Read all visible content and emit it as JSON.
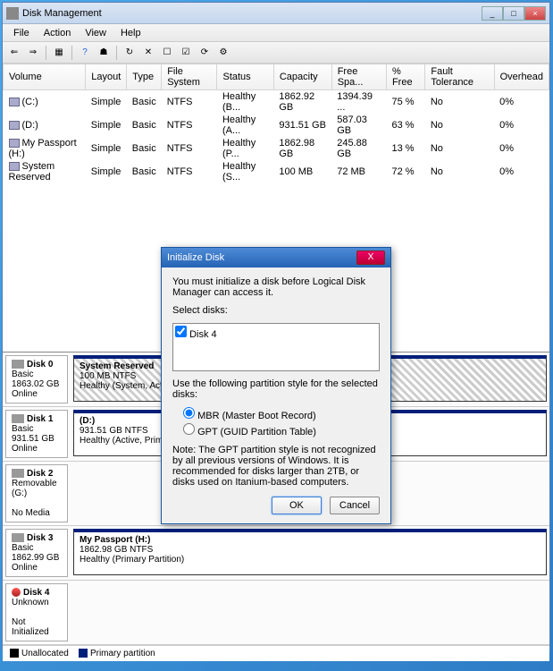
{
  "window": {
    "title": "Disk Management"
  },
  "menu": {
    "file": "File",
    "action": "Action",
    "view": "View",
    "help": "Help"
  },
  "columns": [
    "Volume",
    "Layout",
    "Type",
    "File System",
    "Status",
    "Capacity",
    "Free Spa...",
    "% Free",
    "Fault Tolerance",
    "Overhead"
  ],
  "volumes": [
    {
      "name": "(C:)",
      "layout": "Simple",
      "type": "Basic",
      "fs": "NTFS",
      "status": "Healthy (B...",
      "cap": "1862.92 GB",
      "free": "1394.39 ...",
      "pct": "75 %",
      "ft": "No",
      "oh": "0%"
    },
    {
      "name": "(D:)",
      "layout": "Simple",
      "type": "Basic",
      "fs": "NTFS",
      "status": "Healthy (A...",
      "cap": "931.51 GB",
      "free": "587.03 GB",
      "pct": "63 %",
      "ft": "No",
      "oh": "0%"
    },
    {
      "name": "My Passport (H:)",
      "layout": "Simple",
      "type": "Basic",
      "fs": "NTFS",
      "status": "Healthy (P...",
      "cap": "1862.98 GB",
      "free": "245.88 GB",
      "pct": "13 %",
      "ft": "No",
      "oh": "0%"
    },
    {
      "name": "System Reserved",
      "layout": "Simple",
      "type": "Basic",
      "fs": "NTFS",
      "status": "Healthy (S...",
      "cap": "100 MB",
      "free": "72 MB",
      "pct": "72 %",
      "ft": "No",
      "oh": "0%"
    }
  ],
  "disks": [
    {
      "label": "Disk 0",
      "type": "Basic",
      "size": "1863.02 GB",
      "state": "Online",
      "part": {
        "title": "System Reserved",
        "sub": "100 MB NTFS",
        "status": "Healthy (System, Active, Prim",
        "hatch": true
      }
    },
    {
      "label": "Disk 1",
      "type": "Basic",
      "size": "931.51 GB",
      "state": "Online",
      "part": {
        "title": "(D:)",
        "sub": "931.51 GB NTFS",
        "status": "Healthy (Active, Primary Partition)",
        "hatch": false
      }
    },
    {
      "label": "Disk 2",
      "type": "Removable (G:)",
      "size": "",
      "state": "No Media",
      "part": null
    },
    {
      "label": "Disk 3",
      "type": "Basic",
      "size": "1862.99 GB",
      "state": "Online",
      "part": {
        "title": "My Passport  (H:)",
        "sub": "1862.98 GB NTFS",
        "status": "Healthy (Primary Partition)",
        "hatch": false
      }
    },
    {
      "label": "Disk 4",
      "type": "Unknown",
      "size": "",
      "state": "Not Initialized",
      "part": null,
      "red": true
    }
  ],
  "legend": {
    "unalloc": "Unallocated",
    "primary": "Primary partition"
  },
  "dialog": {
    "title": "Initialize Disk",
    "intro": "You must initialize a disk before Logical Disk Manager can access it.",
    "select_label": "Select disks:",
    "disk_item": "Disk 4",
    "style_label": "Use the following partition style for the selected disks:",
    "opt_mbr": "MBR (Master Boot Record)",
    "opt_gpt": "GPT (GUID Partition Table)",
    "note": "Note: The GPT partition style is not recognized by all previous versions of Windows. It is recommended for disks larger than 2TB, or disks used on Itanium-based computers.",
    "ok": "OK",
    "cancel": "Cancel"
  }
}
